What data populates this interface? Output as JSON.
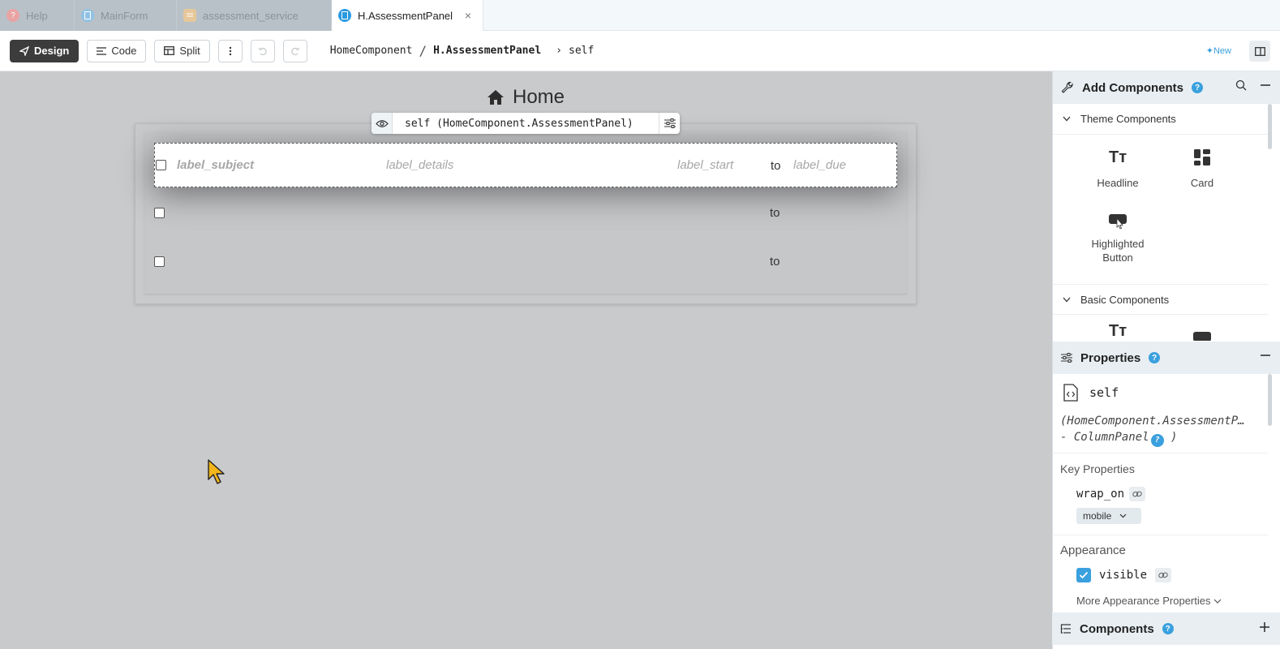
{
  "tabs": [
    {
      "label": "Help",
      "icon": "help-icon",
      "color": "#e07a7a"
    },
    {
      "label": "MainForm",
      "icon": "form-icon",
      "color": "#4aa3df"
    },
    {
      "label": "assessment_service",
      "icon": "module-icon",
      "color": "#e6b56b"
    },
    {
      "label": "H.AssessmentPanel",
      "icon": "form-icon",
      "color": "#2a9ae0",
      "close": "×"
    }
  ],
  "toolbar": {
    "design_label": "Design",
    "code_label": "Code",
    "split_label": "Split",
    "breadcrumb": {
      "root": "HomeComponent",
      "sep": "/",
      "current": "H.AssessmentPanel",
      "arrow": "›",
      "self": "self"
    },
    "new_label": "New"
  },
  "canvas": {
    "title": "Home",
    "overlay_text": "self (HomeComponent.AssessmentPanel)",
    "rows": [
      {
        "subject": "label_subject",
        "details": "label_details",
        "start": "label_start",
        "to": "to",
        "due": "label_due"
      },
      {
        "to": "to"
      },
      {
        "to": "to"
      }
    ]
  },
  "add_components": {
    "title": "Add Components",
    "theme_section": "Theme Components",
    "theme_items": [
      {
        "label": "Headline",
        "icon": "headline-icon"
      },
      {
        "label": "Card",
        "icon": "card-icon"
      },
      {
        "label": "Highlighted Button",
        "icon": "button-icon"
      }
    ],
    "basic_section": "Basic Components"
  },
  "properties": {
    "title": "Properties",
    "name": "self",
    "type_line1": "(HomeComponent.AssessmentP…",
    "type_line2": "- ColumnPanel",
    "key_props_label": "Key Properties",
    "wrap_on_label": "wrap_on",
    "wrap_on_value": "mobile",
    "appearance_label": "Appearance",
    "visible_label": "visible",
    "visible_checked": true,
    "more_appearance": "More Appearance Properties"
  },
  "components_panel": {
    "title": "Components"
  },
  "colors": {
    "accent": "#3aa0de",
    "design_bg": "#3c3c3c"
  }
}
